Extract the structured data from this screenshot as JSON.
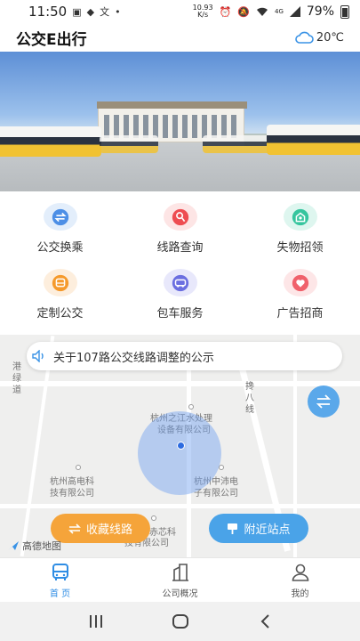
{
  "status_bar": {
    "time": "11:50",
    "speed": "10.93",
    "speed_unit": "K/s",
    "network": "4G",
    "battery": "79%"
  },
  "header": {
    "title": "公交E出行",
    "temperature": "20℃"
  },
  "shortcuts": [
    {
      "label": "公交换乘",
      "icon": "transfer-icon",
      "color": "#4d8fe6",
      "bg": "#e3eefb"
    },
    {
      "label": "线路查询",
      "icon": "route-search-icon",
      "color": "#ee4d52",
      "bg": "#fde5e5"
    },
    {
      "label": "失物招领",
      "icon": "lost-found-icon",
      "color": "#36c59e",
      "bg": "#def6ef"
    },
    {
      "label": "定制公交",
      "icon": "custom-bus-icon",
      "color": "#f59a2c",
      "bg": "#fdeedd"
    },
    {
      "label": "包车服务",
      "icon": "charter-bus-icon",
      "color": "#6b6fe0",
      "bg": "#e8e8fb"
    },
    {
      "label": "广告招商",
      "icon": "advert-heart-icon",
      "color": "#f0616b",
      "bg": "#fde6e7"
    }
  ],
  "map": {
    "notice": "关于107路公交线路调整的公示",
    "labels": {
      "road_left": "港绿道",
      "road_right": "搀八线",
      "poi_center_1": "杭州之江水处理",
      "poi_center_2": "设备有限公司",
      "poi_left_1": "杭州高电科",
      "poi_left_2": "技有限公司",
      "poi_right_1": "杭州中沛电",
      "poi_right_2": "子有限公司",
      "poi_bottom_1": "赤芯科",
      "poi_bottom_2": "技有限公司"
    },
    "favorite_button": "收藏线路",
    "nearby_button": "附近站点",
    "logo_text": "高德地图"
  },
  "tabs": [
    {
      "label": "首 页",
      "icon": "bus-icon",
      "active": true
    },
    {
      "label": "公司概况",
      "icon": "company-building-icon",
      "active": false
    },
    {
      "label": "我的",
      "icon": "person-icon",
      "active": false
    }
  ],
  "colors": {
    "accent": "#2f8de4",
    "favorite": "#f5a43a",
    "nearby": "#4aa3e8"
  }
}
